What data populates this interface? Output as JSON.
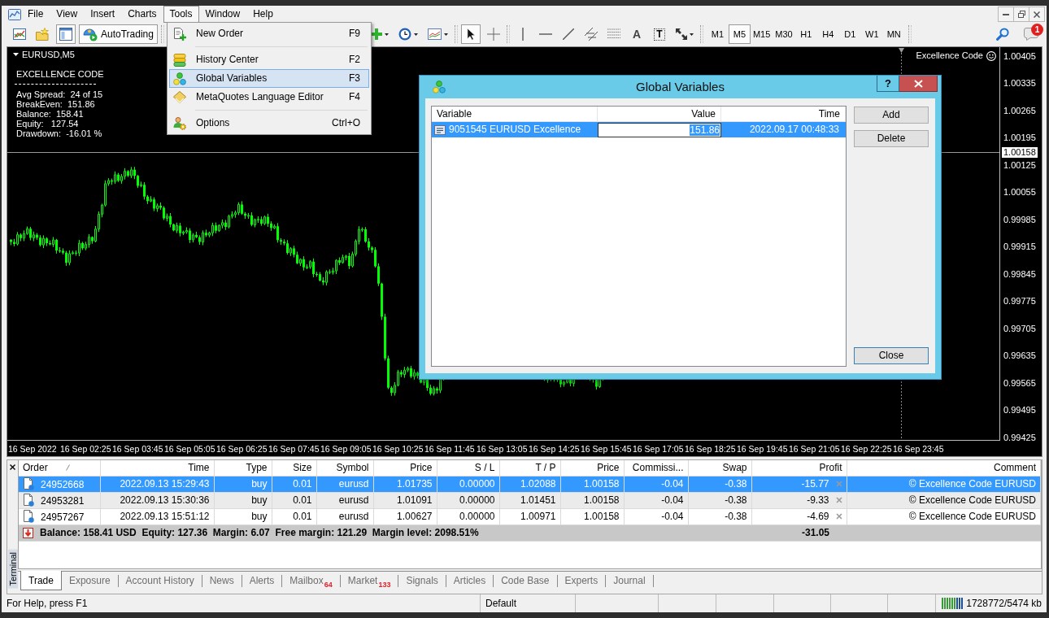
{
  "menu_bar": {
    "items": [
      {
        "label": "File",
        "selected": false
      },
      {
        "label": "View",
        "selected": false
      },
      {
        "label": "Insert",
        "selected": false
      },
      {
        "label": "Charts",
        "selected": false
      },
      {
        "label": "Tools",
        "selected": true
      },
      {
        "label": "Window",
        "selected": false
      },
      {
        "label": "Help",
        "selected": false
      }
    ]
  },
  "toolbar": {
    "chart_buttons": [
      {
        "pressed": false
      },
      {
        "pressed": false
      },
      {
        "pressed": true
      }
    ],
    "autotrading": {
      "label": "AutoTrading",
      "pressed": true
    },
    "pointer_buttons": [
      {
        "pressed": true
      },
      {
        "pressed": false
      }
    ],
    "object_buttons": [
      {
        "kind": "icon",
        "pressed": false
      },
      {
        "kind": "icon",
        "pressed": false
      },
      {
        "kind": "icon",
        "pressed": false
      },
      {
        "kind": "icon",
        "pressed": false
      },
      {
        "kind": "icon",
        "pressed": false
      },
      {
        "kind": "letter",
        "label": "A",
        "pressed": false
      },
      {
        "kind": "framed-letter",
        "label": "T",
        "pressed": false
      },
      {
        "kind": "icon",
        "pressed": false
      }
    ],
    "timeframes": [
      {
        "label": "M1",
        "selected": false
      },
      {
        "label": "M5",
        "selected": true
      },
      {
        "label": "M15",
        "selected": false
      },
      {
        "label": "M30",
        "selected": false
      },
      {
        "label": "H1",
        "selected": false
      },
      {
        "label": "H4",
        "selected": false
      },
      {
        "label": "D1",
        "selected": false
      },
      {
        "label": "W1",
        "selected": false
      },
      {
        "label": "MN",
        "selected": false
      }
    ],
    "notifications": {
      "badge": "1"
    }
  },
  "tools_menu": {
    "items": [
      {
        "kind": "item",
        "label": "New Order",
        "shortcut": "F9",
        "selected": false
      },
      {
        "kind": "separator"
      },
      {
        "kind": "item",
        "label": "History Center",
        "shortcut": "F2",
        "selected": false
      },
      {
        "kind": "item",
        "label": "Global Variables",
        "shortcut": "F3",
        "selected": true
      },
      {
        "kind": "item",
        "label": "MetaQuotes Language Editor",
        "shortcut": "F4",
        "selected": false
      },
      {
        "kind": "separator"
      },
      {
        "kind": "item",
        "label": "Options",
        "shortcut": "Ctrl+O",
        "selected": false
      }
    ]
  },
  "chart": {
    "symbol": "EURUSD,M5",
    "indicator": {
      "title": "EXCELLENCE CODE",
      "lines": [
        "Avg Spread:  24 of 15",
        "BreakEven:  151.86",
        "Balance:  158.41",
        "Equity:   127.54",
        "Drawdown:  -16.01 %"
      ]
    },
    "expert": {
      "label": "Excellence Code",
      "running": true
    },
    "price_labels": [
      "1.00405",
      "1.00335",
      "1.00265",
      "1.00195",
      "1.00125",
      "1.00055",
      "0.99985",
      "0.99915",
      "0.99845",
      "0.99775",
      "0.99705",
      "0.99635",
      "0.99565",
      "0.99495",
      "0.99425"
    ],
    "current_price": "1.00158",
    "time_labels": [
      "16 Sep 2022",
      "16 Sep 02:25",
      "16 Sep 03:45",
      "16 Sep 05:05",
      "16 Sep 06:25",
      "16 Sep 07:45",
      "16 Sep 09:05",
      "16 Sep 10:25",
      "16 Sep 11:45",
      "16 Sep 13:05",
      "16 Sep 14:25",
      "16 Sep 15:45",
      "16 Sep 17:05",
      "16 Sep 18:25",
      "16 Sep 19:45",
      "16 Sep 21:05",
      "16 Sep 22:25",
      "16 Sep 23:45"
    ]
  },
  "dialog": {
    "title": "Global Variables",
    "help": "?",
    "columns": [
      "Variable",
      "Value",
      "Time"
    ],
    "rows": [
      {
        "variable": "9051545 EURUSD Excellence",
        "value": "151.86",
        "time": "2022.09.17 00:48:33",
        "selected": true,
        "editing": true
      }
    ],
    "buttons": [
      {
        "label": "Add",
        "default": false
      },
      {
        "label": "Delete",
        "default": false
      },
      {
        "label": "Close",
        "default": true
      }
    ]
  },
  "terminal": {
    "title": "Terminal",
    "columns": [
      {
        "label": "Order",
        "sorted": true
      },
      {
        "label": "Time",
        "sorted": false
      },
      {
        "label": "Type",
        "sorted": false
      },
      {
        "label": "Size",
        "sorted": false
      },
      {
        "label": "Symbol",
        "sorted": false
      },
      {
        "label": "Price",
        "sorted": false
      },
      {
        "label": "S / L",
        "sorted": false
      },
      {
        "label": "T / P",
        "sorted": false
      },
      {
        "label": "Price",
        "sorted": false
      },
      {
        "label": "Commissi...",
        "sorted": false
      },
      {
        "label": "Swap",
        "sorted": false
      },
      {
        "label": "Profit",
        "sorted": false
      },
      {
        "label": "Comment",
        "sorted": false
      }
    ],
    "rows": [
      {
        "cells": [
          "24952668",
          "2022.09.13 15:29:43",
          "buy",
          "0.01",
          "eurusd",
          "1.01735",
          "0.00000",
          "1.02088",
          "1.00158",
          "-0.04",
          "-0.38",
          "-15.77",
          "© Excellence Code EURUSD"
        ],
        "selected": true
      },
      {
        "cells": [
          "24953281",
          "2022.09.13 15:30:36",
          "buy",
          "0.01",
          "eurusd",
          "1.01091",
          "0.00000",
          "1.01451",
          "1.00158",
          "-0.04",
          "-0.38",
          "-9.33",
          "© Excellence Code EURUSD"
        ],
        "selected": false
      },
      {
        "cells": [
          "24957267",
          "2022.09.13 15:51:12",
          "buy",
          "0.01",
          "eurusd",
          "1.00627",
          "0.00000",
          "1.00971",
          "1.00158",
          "-0.04",
          "-0.38",
          "-4.69",
          "© Excellence Code EURUSD"
        ],
        "selected": false
      }
    ],
    "summary": {
      "text": "Balance: 158.41 USD  Equity: 127.36  Margin: 6.07  Free margin: 121.29  Margin level: 2098.51%",
      "profit": "-31.05"
    },
    "tabs": [
      {
        "label": "Trade",
        "selected": true
      },
      {
        "label": "Exposure",
        "selected": false
      },
      {
        "label": "Account History",
        "selected": false
      },
      {
        "label": "News",
        "selected": false
      },
      {
        "label": "Alerts",
        "selected": false
      },
      {
        "label": "Mailbox",
        "badge": "64",
        "selected": false
      },
      {
        "label": "Market",
        "badge": "133",
        "selected": false
      },
      {
        "label": "Signals",
        "selected": false
      },
      {
        "label": "Articles",
        "selected": false
      },
      {
        "label": "Code Base",
        "selected": false
      },
      {
        "label": "Experts",
        "selected": false
      },
      {
        "label": "Journal",
        "selected": false
      }
    ]
  },
  "status_bar": {
    "help": "For Help, press F1",
    "profile": "Default",
    "traffic": "1728772/5474 kb"
  }
}
